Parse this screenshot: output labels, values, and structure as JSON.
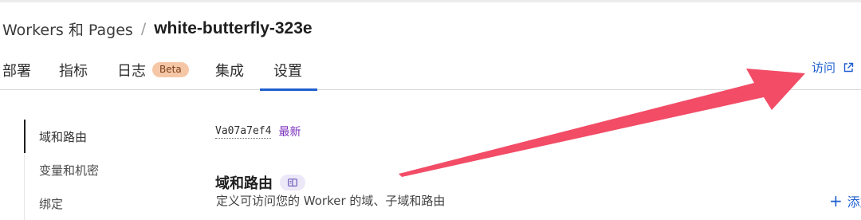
{
  "breadcrumb": {
    "parent": "Workers 和 Pages",
    "separator": "/",
    "current": "white-butterfly-323e"
  },
  "tabs": [
    {
      "label": "部署"
    },
    {
      "label": "指标"
    },
    {
      "label": "日志",
      "badge": "Beta"
    },
    {
      "label": "集成"
    },
    {
      "label": "设置",
      "active": true
    }
  ],
  "visit": {
    "label": "访问",
    "icon": "external-link-icon"
  },
  "sidebar": {
    "items": [
      {
        "label": "域和路由",
        "active": true
      },
      {
        "label": "变量和机密"
      },
      {
        "label": "绑定"
      }
    ]
  },
  "version": {
    "id": "Va07a7ef4",
    "tag": "最新"
  },
  "section": {
    "title": "域和路由",
    "icon": "book-icon",
    "description": "定义可访问您的 Worker 的域、子域和路由"
  },
  "add_button": {
    "label": "添加",
    "icon": "plus-icon"
  },
  "colors": {
    "accent": "#1f5fcf",
    "annotation_arrow": "#f24c66",
    "badge_bg": "#f6c7a6",
    "version_tag": "#7b2fbf"
  }
}
